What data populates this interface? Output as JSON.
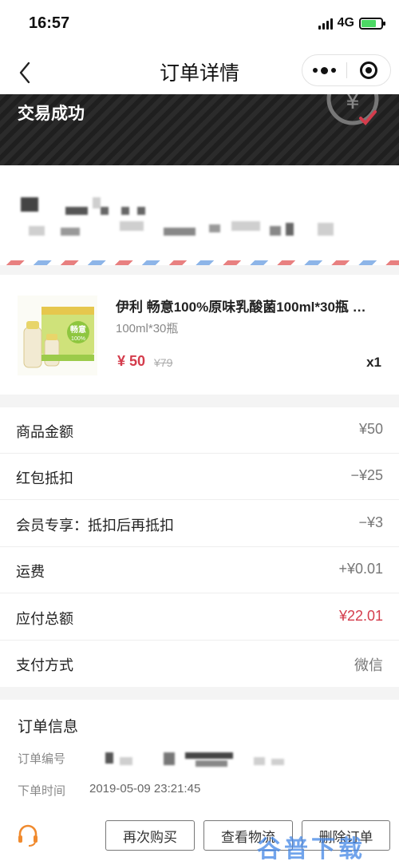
{
  "status_bar": {
    "time": "16:57",
    "network": "4G"
  },
  "nav": {
    "title": "订单详情"
  },
  "banner": {
    "status": "交易成功",
    "seal_char": "¥"
  },
  "product": {
    "name": "伊利 畅意100%原味乳酸菌100ml*30瓶 …",
    "spec": "100ml*30瓶",
    "price": "¥ 50",
    "original_price": "¥79",
    "quantity": "x1",
    "package_text": "畅意",
    "package_sub": "100%"
  },
  "summary": {
    "rows": [
      {
        "label": "商品金额",
        "value": "¥50"
      },
      {
        "label": "红包抵扣",
        "value": "−¥25"
      },
      {
        "label": "会员专享：抵扣后再抵扣",
        "value": "−¥3"
      },
      {
        "label": "运费",
        "value": "+¥0.01"
      },
      {
        "label": "应付总额",
        "value": "¥22.01"
      },
      {
        "label": "支付方式",
        "value": "微信"
      }
    ]
  },
  "order_info": {
    "title": "订单信息",
    "number_label": "订单编号",
    "time_label": "下单时间",
    "time_value": "2019-05-09 23:21:45"
  },
  "actions": {
    "buy_again": "再次购买",
    "view_logistics": "查看物流",
    "delete_order": "删除订单"
  },
  "watermark": "谷普下载",
  "colors": {
    "accent_red": "#d43c4c",
    "success_green": "#4cd964"
  }
}
